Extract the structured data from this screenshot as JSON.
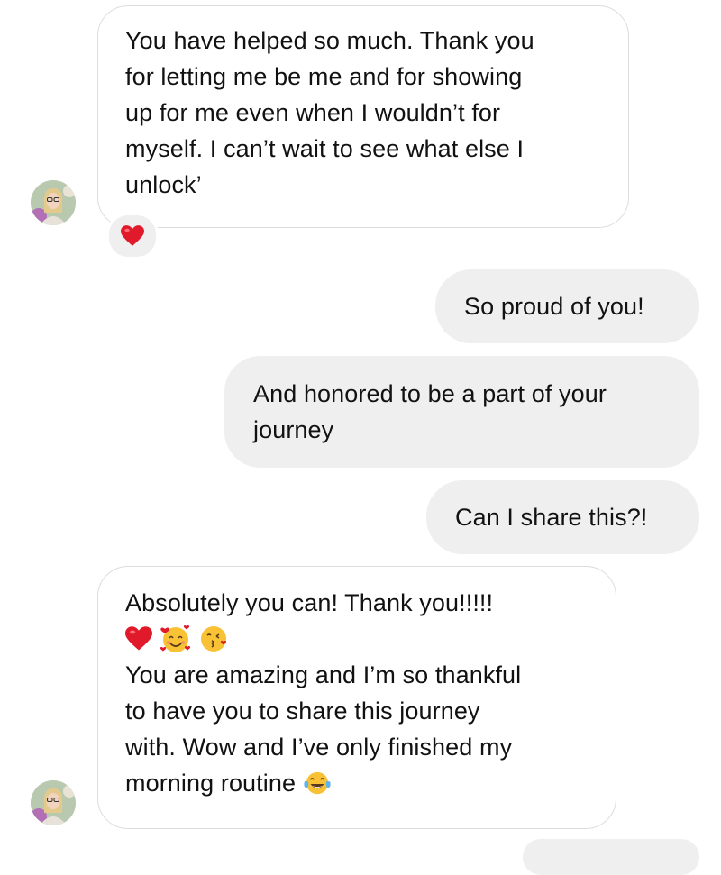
{
  "thread": {
    "messages": [
      {
        "direction": "incoming",
        "lines": [
          "You have helped so much. Thank you",
          "for letting me be me and for showing",
          "up for me even when I wouldn’t for",
          "myself. I can’t wait to see what else I",
          "unlock’"
        ],
        "reaction_icon": "red-heart-emoji"
      },
      {
        "direction": "outgoing",
        "lines": [
          "So proud of you!"
        ]
      },
      {
        "direction": "outgoing",
        "lines": [
          "And honored to be a part of your",
          "journey"
        ]
      },
      {
        "direction": "outgoing",
        "lines": [
          "Can I share this?!"
        ]
      },
      {
        "direction": "incoming",
        "lines": [
          "Absolutely you can! Thank you!!!!!",
          "You are amazing and I’m so thankful",
          "to have you to share this journey",
          "with. Wow and I’ve only finished my",
          "morning routine"
        ],
        "emoji_row_icons": [
          "red-heart-emoji",
          "smiling-face-with-hearts-emoji",
          "face-blowing-kiss-emoji"
        ],
        "trailing_icon": "face-with-tears-of-joy-emoji"
      }
    ]
  },
  "colors": {
    "incoming_bubble_bg": "#ffffff",
    "incoming_bubble_border": "#dcdcdc",
    "outgoing_bubble_bg": "#efefef",
    "heart_red": "#e0192b",
    "emoji_yellow": "#f8c234"
  }
}
